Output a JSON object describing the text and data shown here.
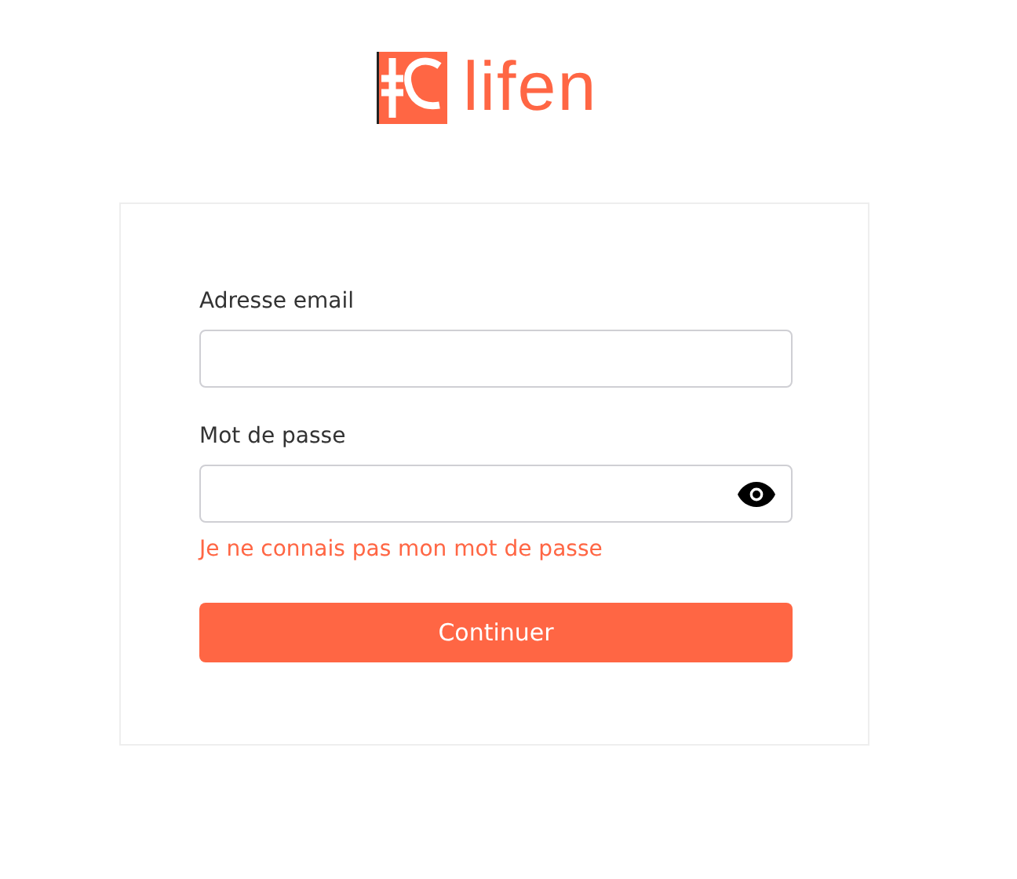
{
  "logo": {
    "text": "lifen"
  },
  "form": {
    "fields": [
      {
        "label": "Adresse email",
        "kind": "text"
      },
      {
        "label": "Mot de passe",
        "kind": "password"
      }
    ],
    "forgot_link": "Je ne connais pas mon mot de passe",
    "submit": "Continuer"
  }
}
